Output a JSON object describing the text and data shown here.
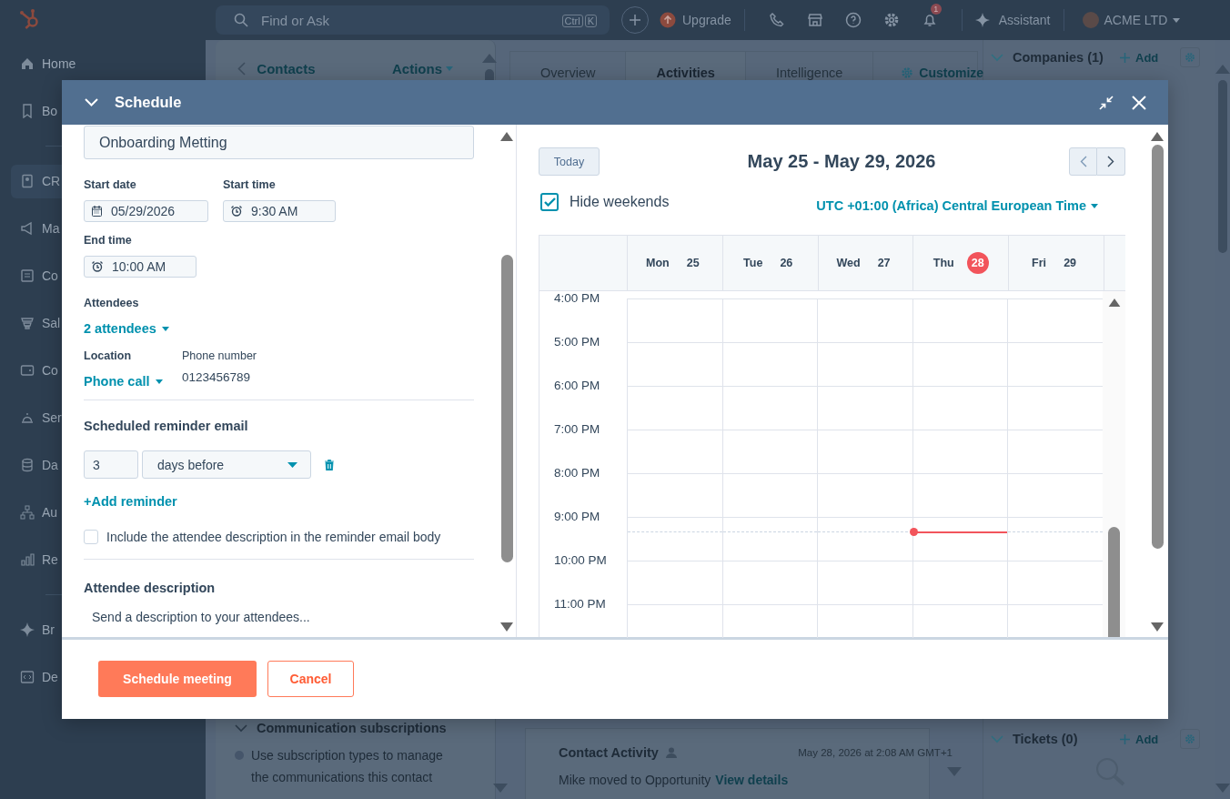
{
  "top_bar": {
    "search": {
      "placeholder": "Find or Ask",
      "keys": [
        "Ctrl",
        "K"
      ]
    },
    "upgrade": "Upgrade",
    "notifications": "1",
    "assistant": "Assistant",
    "account": "ACME LTD"
  },
  "sidebar": {
    "groups": [
      {
        "items": [
          {
            "label": "Home",
            "selected": false
          },
          {
            "label": "Bo",
            "selected": false
          }
        ]
      },
      {
        "items": [
          {
            "label": "CR",
            "selected": true
          },
          {
            "label": "Ma",
            "selected": false
          },
          {
            "label": "Co",
            "selected": false
          },
          {
            "label": "Sal",
            "selected": false
          },
          {
            "label": "Co",
            "selected": false
          },
          {
            "label": "Ser",
            "selected": false
          },
          {
            "label": "Da",
            "selected": false
          },
          {
            "label": "Au",
            "selected": false
          },
          {
            "label": "Re",
            "selected": false
          }
        ]
      },
      {
        "items": [
          {
            "label": "Br",
            "selected": false
          },
          {
            "label": "De",
            "selected": false
          }
        ]
      }
    ]
  },
  "record": {
    "back": "Contacts",
    "actions": "Actions",
    "tabs": [
      {
        "label": "Overview",
        "selected": false
      },
      {
        "label": "Activities",
        "selected": true
      },
      {
        "label": "Intelligence",
        "selected": false
      }
    ],
    "customize": "Customize",
    "side_sections": [
      {
        "title": "Companies (1)",
        "action": "Add"
      },
      {
        "title": "Tickets (0)",
        "action": "Add"
      }
    ],
    "subscriptions": {
      "title": "Communication subscriptions",
      "text": "Use subscription types to manage the communications this contact"
    },
    "activity": {
      "title": "Contact Activity",
      "time": "May 28, 2026 at 2:08 AM GMT+1",
      "text": "Mike moved to Opportunity",
      "link": "View details"
    }
  },
  "schedule": {
    "title": "Schedule",
    "form": {
      "meeting_title": "Onboarding Metting",
      "start_date": {
        "label": "Start date",
        "value": "05/29/2026"
      },
      "start_time": {
        "label": "Start time",
        "value": "9:30 AM"
      },
      "end_time": {
        "label": "End time",
        "value": "10:00 AM"
      },
      "attendees": {
        "label": "Attendees",
        "value": "2 attendees"
      },
      "location": {
        "label": "Location",
        "value": "Phone call"
      },
      "phone": {
        "label": "Phone number",
        "value": "0123456789"
      },
      "reminder": {
        "heading": "Scheduled reminder email",
        "amount": "3",
        "unit": "days before",
        "add": "+Add reminder"
      },
      "include_description": {
        "label": "Include the attendee description in the reminder email body",
        "checked": false
      },
      "description": {
        "label": "Attendee description",
        "placeholder": "Send a description to your attendees..."
      }
    },
    "calendar": {
      "today_button": "Today",
      "range": "May 25 - May 29, 2026",
      "hide_weekends": {
        "label": "Hide weekends",
        "checked": true
      },
      "timezone": "UTC +01:00 (Africa) Central European Time",
      "days": [
        {
          "name": "Mon",
          "date": "25",
          "today": false
        },
        {
          "name": "Tue",
          "date": "26",
          "today": false
        },
        {
          "name": "Wed",
          "date": "27",
          "today": false
        },
        {
          "name": "Thu",
          "date": "28",
          "today": true
        },
        {
          "name": "Fri",
          "date": "29",
          "today": false
        }
      ],
      "hours": [
        "4:00 PM",
        "5:00 PM",
        "6:00 PM",
        "7:00 PM",
        "8:00 PM",
        "9:00 PM",
        "10:00 PM",
        "11:00 PM"
      ]
    },
    "buttons": {
      "primary": "Schedule meeting",
      "cancel": "Cancel"
    }
  }
}
